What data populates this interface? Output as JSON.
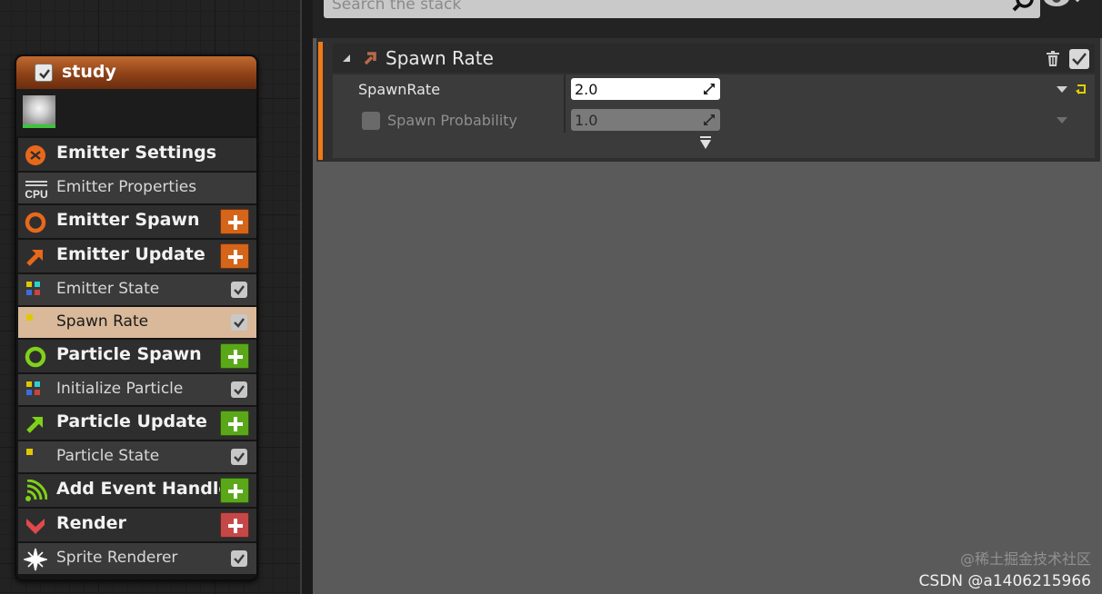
{
  "node": {
    "title": "study",
    "enabled": true,
    "sections": [
      {
        "id": "emitter-settings",
        "label": "Emitter Settings",
        "kind": "section",
        "icon": "emitter-settings-icon",
        "color": "#e8681a"
      },
      {
        "id": "emitter-properties",
        "label": "Emitter Properties",
        "kind": "item",
        "icon": "cpu-icon"
      },
      {
        "id": "emitter-spawn",
        "label": "Emitter Spawn",
        "kind": "section",
        "icon": "spawn-ring-icon",
        "color": "#e8681a",
        "add_color": "#d4651a"
      },
      {
        "id": "emitter-update",
        "label": "Emitter Update",
        "kind": "section",
        "icon": "update-arrow-icon",
        "color": "#e8681a",
        "add_color": "#d4651a"
      },
      {
        "id": "emitter-state",
        "label": "Emitter State",
        "kind": "item",
        "icon": "module-dots-icon",
        "checked": true
      },
      {
        "id": "spawn-rate",
        "label": "Spawn Rate",
        "kind": "item",
        "icon": "module-dot-icon",
        "checked": true,
        "selected": true
      },
      {
        "id": "particle-spawn",
        "label": "Particle Spawn",
        "kind": "section",
        "icon": "spawn-ring-icon",
        "color": "#7fd11a",
        "add_color": "#5aa81a"
      },
      {
        "id": "initialize-particle",
        "label": "Initialize Particle",
        "kind": "item",
        "icon": "module-dots-icon",
        "checked": true
      },
      {
        "id": "particle-update",
        "label": "Particle Update",
        "kind": "section",
        "icon": "update-arrow-icon",
        "color": "#7fd11a",
        "add_color": "#5aa81a"
      },
      {
        "id": "particle-state",
        "label": "Particle State",
        "kind": "item",
        "icon": "module-dot-icon",
        "checked": true
      },
      {
        "id": "add-event-handler",
        "label": "Add Event Handler",
        "kind": "section",
        "icon": "event-signal-icon",
        "color": "#7fd11a",
        "add_color": "#5aa81a"
      },
      {
        "id": "render",
        "label": "Render",
        "kind": "section",
        "icon": "render-chevron-icon",
        "color": "#e04a4a",
        "add_color": "#c44848"
      },
      {
        "id": "sprite-renderer",
        "label": "Sprite Renderer",
        "kind": "item",
        "icon": "sprite-star-icon",
        "checked": true
      }
    ]
  },
  "stack": {
    "search_placeholder": "Search the stack",
    "module": {
      "title": "Spawn Rate",
      "enabled": true,
      "params": [
        {
          "name": "SpawnRate",
          "value": "2.0",
          "enabled": true
        },
        {
          "name": "Spawn Probability",
          "value": "1.0",
          "enabled": false
        }
      ]
    }
  },
  "watermark": {
    "line1": "@稀土掘金技术社区",
    "line2": "CSDN @a1406215966"
  }
}
